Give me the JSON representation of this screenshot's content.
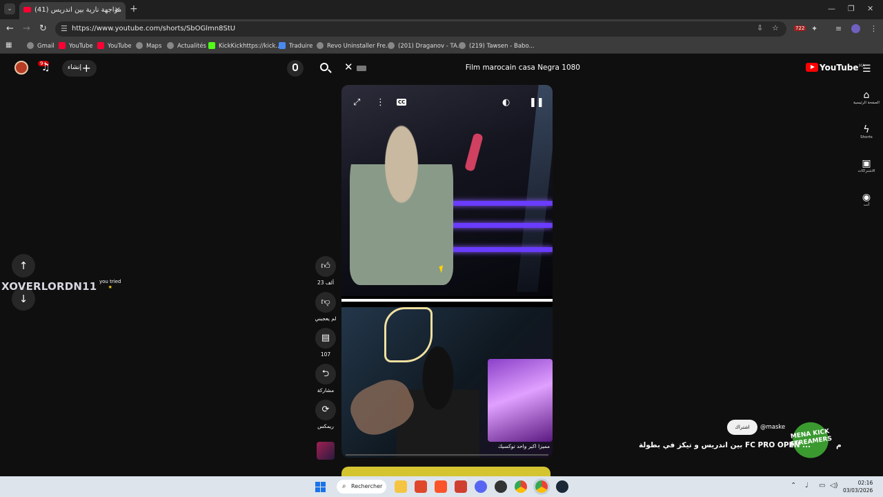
{
  "browser": {
    "tab_title": "(41) مواجهة نارية بين اندريس",
    "url": "https://www.youtube.com/shorts/SbOGlmn8StU",
    "extension_badge": "722",
    "bookmarks": [
      "Gmail",
      "YouTube",
      "YouTube",
      "Maps",
      "Actualités",
      "KickKickhttps://kick...",
      "Traduire",
      "Revo Uninstaller Fre...",
      "(201) Draganov - TA...",
      "(219) Tawsen - Babo..."
    ]
  },
  "youtube": {
    "create_label": "إنشاء",
    "notification_count": "9+",
    "search_query": "Film marocain casa Negra 1080",
    "logo_text": "YouTube",
    "region": "MA",
    "nav": [
      {
        "label": "الصفحة الرئيسية",
        "icon": "home-icon"
      },
      {
        "label": "Shorts",
        "icon": "shorts-icon"
      },
      {
        "label": "الاشتراكات",
        "icon": "subscriptions-icon"
      },
      {
        "label": "أنت",
        "icon": "you-icon"
      }
    ],
    "overlay_name": "XOVERLORDN11",
    "overlay_tag": "you tried",
    "actions": {
      "like_count": "23 ألف",
      "dislike_label": "لم يعجبني",
      "comment_count": "107",
      "share_label": "مشاركة",
      "remix_label": "ريمكس"
    },
    "video": {
      "caption": "مميزا اكبر واحد توكسيك",
      "subscribe_label": "اشتراك",
      "channel": "@maske",
      "title_visible": "بين اندريس و تيكز في بطولة FC PRO OPEN ...",
      "title_cut": "م",
      "logo_text": "MENA KICK STREAMERS"
    }
  },
  "taskbar": {
    "search_label": "Rechercher",
    "time": "02:16",
    "date": "03/03/2026"
  }
}
